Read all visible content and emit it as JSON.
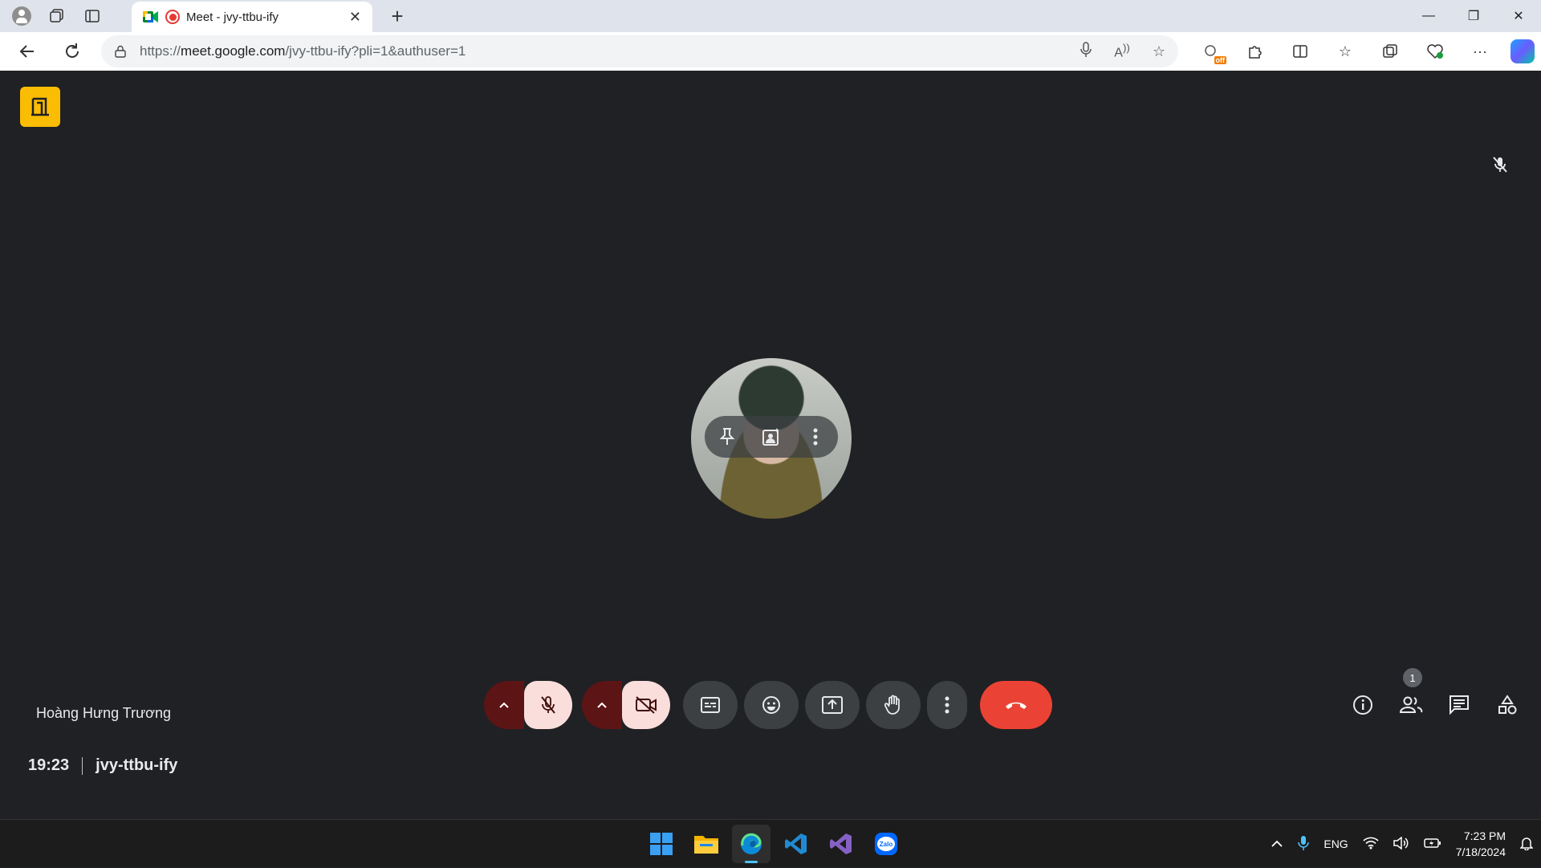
{
  "browser": {
    "tab_title": "Meet - jvy-ttbu-ify",
    "url_prefix": "https://",
    "url_host": "meet.google.com",
    "url_path": "/jvy-ttbu-ify?pli=1&authuser=1",
    "extension_badge": "off"
  },
  "meet": {
    "participant_name": "Hoàng Hưng Trương",
    "time": "19:23",
    "meeting_code": "jvy-ttbu-ify",
    "participant_count": "1",
    "colors": {
      "background": "#202124",
      "hangup": "#ea4335",
      "muted_bg": "#f9dedc",
      "muted_caret": "#5c1414",
      "brand_tile": "#fbbc04"
    }
  },
  "taskbar": {
    "language": "ENG",
    "time": "7:23 PM",
    "date": "7/18/2024"
  }
}
